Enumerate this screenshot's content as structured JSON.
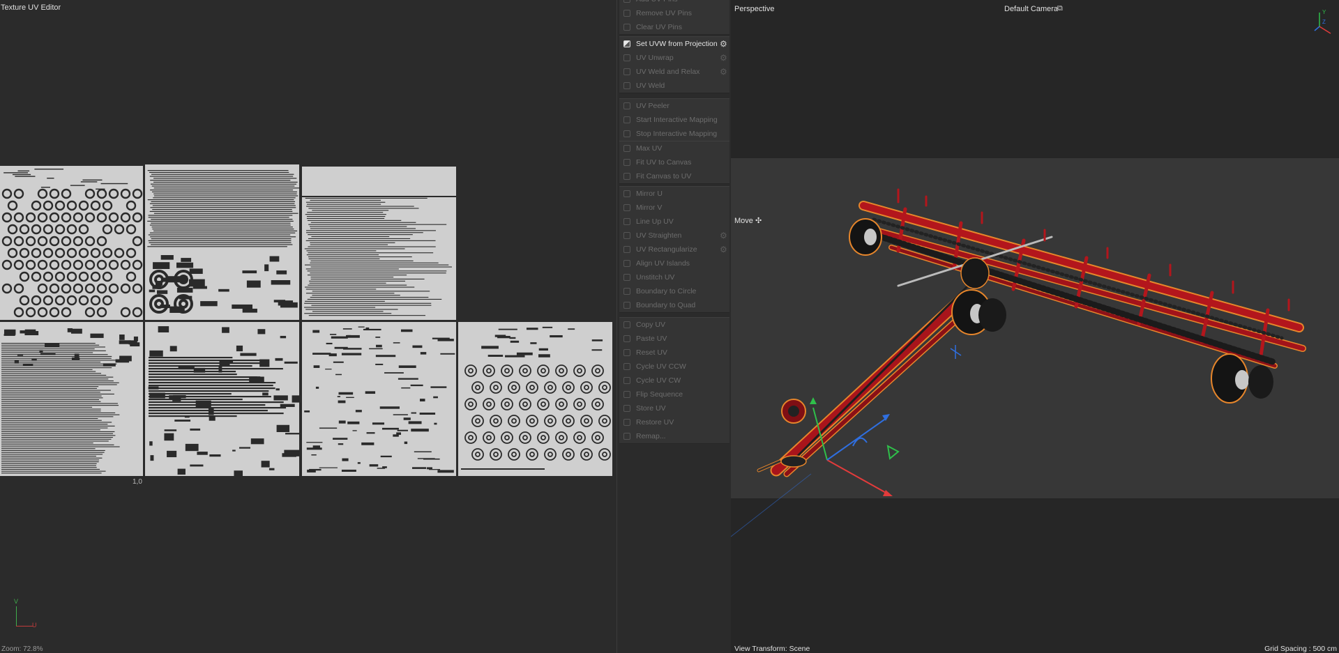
{
  "uv_editor": {
    "title": "Texture UV Editor",
    "zoom": "Zoom: 72.8%",
    "coord_label": "1,0",
    "axis_v": "V",
    "axis_u": "U"
  },
  "commands": {
    "groups": [
      {
        "items": [
          {
            "label": "Add UV Pins",
            "gear": false,
            "active": false,
            "icon": "pin-add-icon"
          },
          {
            "label": "Remove UV Pins",
            "gear": false,
            "active": false,
            "icon": "pin-remove-icon"
          },
          {
            "label": "Clear UV Pins",
            "gear": false,
            "active": false,
            "icon": "pin-clear-icon"
          }
        ]
      },
      {
        "items": [
          {
            "label": "Set UVW from Projection",
            "gear": true,
            "active": true,
            "icon": "projection-icon"
          },
          {
            "label": "UV Unwrap",
            "gear": true,
            "active": false,
            "icon": "unwrap-icon"
          },
          {
            "label": "UV Weld and Relax",
            "gear": true,
            "active": false,
            "icon": "weld-relax-icon"
          },
          {
            "label": "UV Weld",
            "gear": false,
            "active": false,
            "icon": "weld-icon"
          }
        ]
      },
      {
        "items": [
          {
            "label": "UV Peeler",
            "gear": false,
            "active": false,
            "icon": "peeler-icon"
          },
          {
            "label": "Start Interactive Mapping",
            "gear": false,
            "active": false,
            "icon": "play-icon"
          },
          {
            "label": "Stop Interactive Mapping",
            "gear": false,
            "active": false,
            "icon": "stop-icon"
          }
        ]
      },
      {
        "items": [
          {
            "label": "Max UV",
            "gear": false,
            "active": false,
            "icon": "max-uv-icon"
          },
          {
            "label": "Fit UV to Canvas",
            "gear": false,
            "active": false,
            "icon": "fit-canvas-icon"
          },
          {
            "label": "Fit Canvas to UV",
            "gear": false,
            "active": false,
            "icon": "fit-uv-icon"
          }
        ]
      },
      {
        "items": [
          {
            "label": "Mirror U",
            "gear": false,
            "active": false,
            "icon": "mirror-u-icon"
          },
          {
            "label": "Mirror V",
            "gear": false,
            "active": false,
            "icon": "mirror-v-icon"
          },
          {
            "label": "Line Up UV",
            "gear": false,
            "active": false,
            "icon": "line-up-icon"
          },
          {
            "label": "UV Straighten",
            "gear": true,
            "active": false,
            "icon": "straighten-icon"
          },
          {
            "label": "UV Rectangularize",
            "gear": true,
            "active": false,
            "icon": "rectangularize-icon"
          },
          {
            "label": "Align UV Islands",
            "gear": false,
            "active": false,
            "icon": "align-icon"
          },
          {
            "label": "Unstitch UV",
            "gear": false,
            "active": false,
            "icon": "unstitch-icon"
          },
          {
            "label": "Boundary to Circle",
            "gear": false,
            "active": false,
            "icon": "circle-icon"
          },
          {
            "label": "Boundary to Quad",
            "gear": false,
            "active": false,
            "icon": "quad-icon"
          }
        ]
      },
      {
        "items": [
          {
            "label": "Copy UV",
            "gear": false,
            "active": false,
            "icon": "copy-icon"
          },
          {
            "label": "Paste UV",
            "gear": false,
            "active": false,
            "icon": "paste-icon"
          },
          {
            "label": "Reset UV",
            "gear": false,
            "active": false,
            "icon": "reset-icon"
          },
          {
            "label": "Cycle UV CCW",
            "gear": false,
            "active": false,
            "icon": "cycle-ccw-icon"
          },
          {
            "label": "Cycle UV CW",
            "gear": false,
            "active": false,
            "icon": "cycle-cw-icon"
          },
          {
            "label": "Flip Sequence",
            "gear": false,
            "active": false,
            "icon": "flip-icon"
          },
          {
            "label": "Store UV",
            "gear": false,
            "active": false,
            "icon": "store-icon"
          },
          {
            "label": "Restore UV",
            "gear": false,
            "active": false,
            "icon": "restore-icon"
          },
          {
            "label": "Remap...",
            "gear": false,
            "active": false,
            "icon": "remap-icon"
          }
        ]
      }
    ]
  },
  "viewport": {
    "title": "Perspective",
    "camera": "Default Camera",
    "camera_icon": "⧉",
    "tool": "Move ✣",
    "view_transform": "View Transform: Scene",
    "grid_spacing": "Grid Spacing : 500 cm",
    "gizmo_y": "Y",
    "gizmo_z": "Z",
    "colors": {
      "model": "#b3161c",
      "outline": "#e7862b",
      "axis_x": "#e23b3b",
      "axis_y": "#2fbf4a",
      "axis_z": "#2f6fe0"
    }
  }
}
